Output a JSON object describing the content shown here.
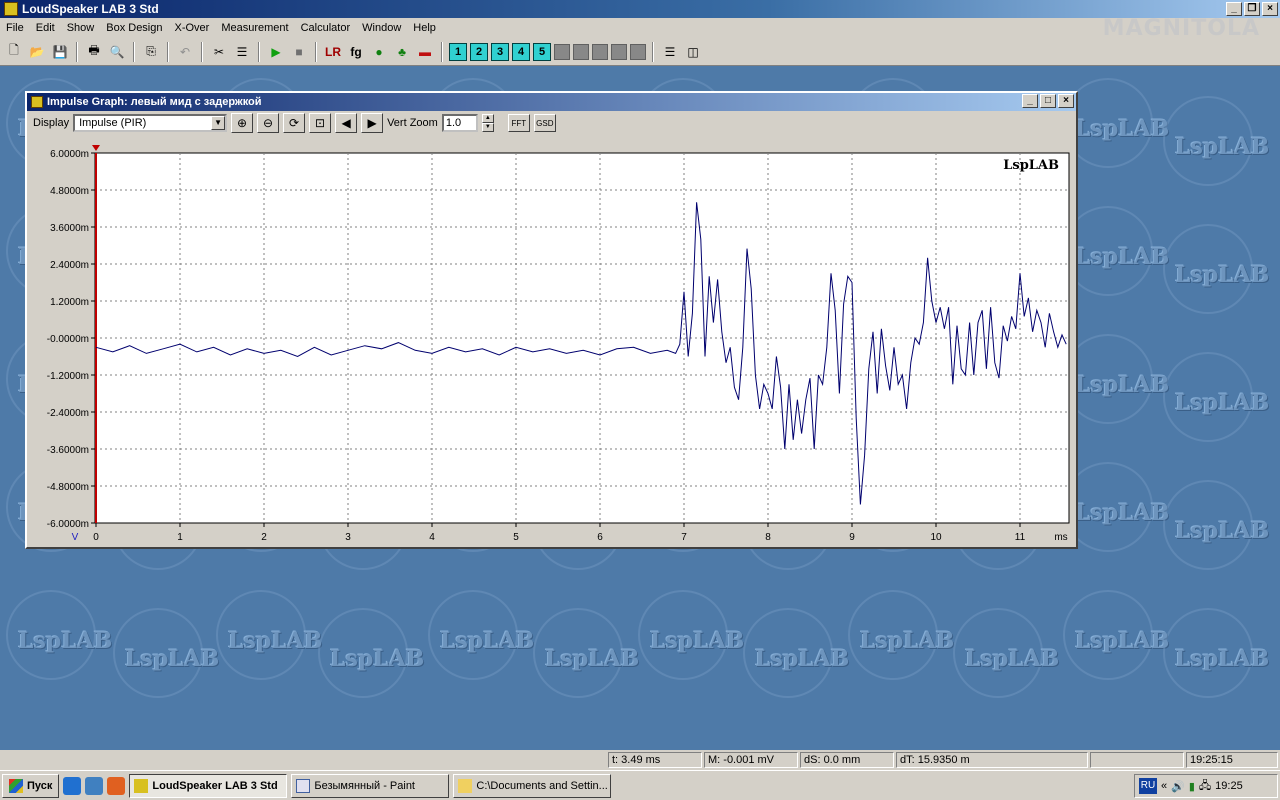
{
  "app": {
    "title": "LoudSpeaker LAB 3 Std",
    "brand": "MAGNITOLA"
  },
  "menu": [
    "File",
    "Edit",
    "Show",
    "Box Design",
    "X-Over",
    "Measurement",
    "Calculator",
    "Window",
    "Help"
  ],
  "toolbar": {
    "icons": [
      "new-icon",
      "open-icon",
      "save-icon",
      "print-icon",
      "print-preview-icon",
      "copy-icon",
      "undo-icon",
      "tools-icon",
      "equalizer-icon",
      "play-icon",
      "stop-icon",
      "lr-icon",
      "fg-icon",
      "green-circle-icon",
      "tree-icon",
      "red-chart-icon"
    ],
    "number_buttons": [
      "1",
      "2",
      "3",
      "4",
      "5"
    ]
  },
  "child_window": {
    "title": "Impulse Graph: левый мид с задержкой",
    "display_label": "Display",
    "display_value": "Impulse (PIR)",
    "vert_zoom_label": "Vert Zoom",
    "vert_zoom_value": "1.0",
    "fft_label": "FFT",
    "gsd_label": "GSD"
  },
  "watermark": "LspLAB",
  "chart_data": {
    "type": "line",
    "title": "",
    "watermark": "LspLAB",
    "xlabel": "ms",
    "ylabel": "V",
    "xlim": [
      0,
      11.6
    ],
    "ylim": [
      -6.0,
      6.0
    ],
    "x_ticks": [
      "0",
      "1",
      "2",
      "3",
      "4",
      "5",
      "6",
      "7",
      "8",
      "9",
      "10",
      "11"
    ],
    "y_ticks": [
      "6.0000m",
      "4.8000m",
      "3.6000m",
      "2.4000m",
      "1.2000m",
      "-0.0000m",
      "-1.2000m",
      "-2.4000m",
      "-3.6000m",
      "-4.8000m",
      "-6.0000m"
    ],
    "grid": true,
    "series_color": "#00006e",
    "series": [
      {
        "x": [
          0,
          0.2,
          0.4,
          0.6,
          0.8,
          1.0,
          1.2,
          1.4,
          1.6,
          1.8,
          2.0,
          2.2,
          2.4,
          2.6,
          2.8,
          3.0,
          3.2,
          3.4,
          3.6,
          3.8,
          4.0,
          4.2,
          4.4,
          4.6,
          4.8,
          5.0,
          5.2,
          5.4,
          5.6,
          5.8,
          6.0,
          6.2,
          6.4,
          6.6,
          6.8,
          6.9,
          6.95,
          7.0,
          7.05,
          7.1,
          7.15,
          7.2,
          7.25,
          7.3,
          7.35,
          7.4,
          7.45,
          7.5,
          7.55,
          7.6,
          7.65,
          7.7,
          7.75,
          7.8,
          7.85,
          7.9,
          7.95,
          8.0,
          8.05,
          8.1,
          8.15,
          8.2,
          8.25,
          8.3,
          8.35,
          8.4,
          8.45,
          8.5,
          8.55,
          8.6,
          8.65,
          8.7,
          8.75,
          8.8,
          8.85,
          8.9,
          8.95,
          9.0,
          9.05,
          9.1,
          9.15,
          9.2,
          9.25,
          9.3,
          9.35,
          9.4,
          9.45,
          9.5,
          9.55,
          9.6,
          9.65,
          9.7,
          9.75,
          9.8,
          9.85,
          9.9,
          9.95,
          10.0,
          10.05,
          10.1,
          10.15,
          10.2,
          10.25,
          10.3,
          10.35,
          10.4,
          10.45,
          10.5,
          10.55,
          10.6,
          10.65,
          10.7,
          10.75,
          10.8,
          10.85,
          10.9,
          10.95,
          11.0,
          11.05,
          11.1,
          11.15,
          11.2,
          11.25,
          11.3,
          11.35,
          11.4,
          11.45,
          11.5,
          11.55
        ],
        "y": [
          -0.3,
          -0.45,
          -0.25,
          -0.5,
          -0.35,
          -0.2,
          -0.45,
          -0.3,
          -0.55,
          -0.35,
          -0.5,
          -0.4,
          -0.6,
          -0.3,
          -0.55,
          -0.4,
          -0.25,
          -0.35,
          -0.15,
          -0.4,
          -0.5,
          -0.3,
          -0.45,
          -0.35,
          -0.55,
          -0.3,
          -0.45,
          -0.35,
          -0.5,
          -0.4,
          -0.55,
          -0.35,
          -0.3,
          -0.5,
          -0.4,
          -0.5,
          -0.2,
          1.5,
          -0.6,
          0.8,
          4.4,
          3.2,
          -0.6,
          2.0,
          0.5,
          1.9,
          0.2,
          -0.8,
          -0.3,
          -1.6,
          -2.0,
          -0.3,
          2.9,
          1.6,
          -1.2,
          -2.3,
          -1.5,
          -1.8,
          -2.3,
          -0.6,
          -1.6,
          -3.6,
          -1.5,
          -3.3,
          -2.0,
          -3.1,
          -2.0,
          -1.3,
          -3.6,
          -1.2,
          -1.5,
          -0.3,
          2.1,
          0.9,
          -1.8,
          1.1,
          2.0,
          1.8,
          -2.6,
          -5.4,
          -3.8,
          -1.0,
          0.2,
          -1.8,
          0.3,
          -0.9,
          -1.7,
          -0.3,
          -1.5,
          -1.2,
          -2.3,
          -0.8,
          0.0,
          -0.2,
          0.5,
          2.6,
          1.2,
          0.5,
          1.0,
          0.3,
          1.0,
          -1.5,
          0.4,
          -1.0,
          -1.2,
          0.5,
          -1.2,
          0.5,
          0.9,
          -1.0,
          1.0,
          -0.8,
          -1.3,
          0.4,
          -0.1,
          0.7,
          0.3,
          2.1,
          0.7,
          1.3,
          0.2,
          0.9,
          0.5,
          -0.3,
          0.8,
          0.2,
          -0.3,
          0.1,
          -0.2
        ]
      }
    ]
  },
  "status": {
    "t": "t: 3.49 ms",
    "m": "M: -0.001 mV",
    "ds": "dS: 0.0 mm",
    "dt": "dT: 15.9350 m",
    "time": "19:25:15"
  },
  "taskbar": {
    "start": "Пуск",
    "tasks": [
      {
        "label": "LoudSpeaker LAB 3 Std",
        "active": true
      },
      {
        "label": "Безымянный - Paint",
        "active": false
      },
      {
        "label": "C:\\Documents and Settin...",
        "active": false
      }
    ],
    "lang": "RU",
    "clock": "19:25"
  }
}
